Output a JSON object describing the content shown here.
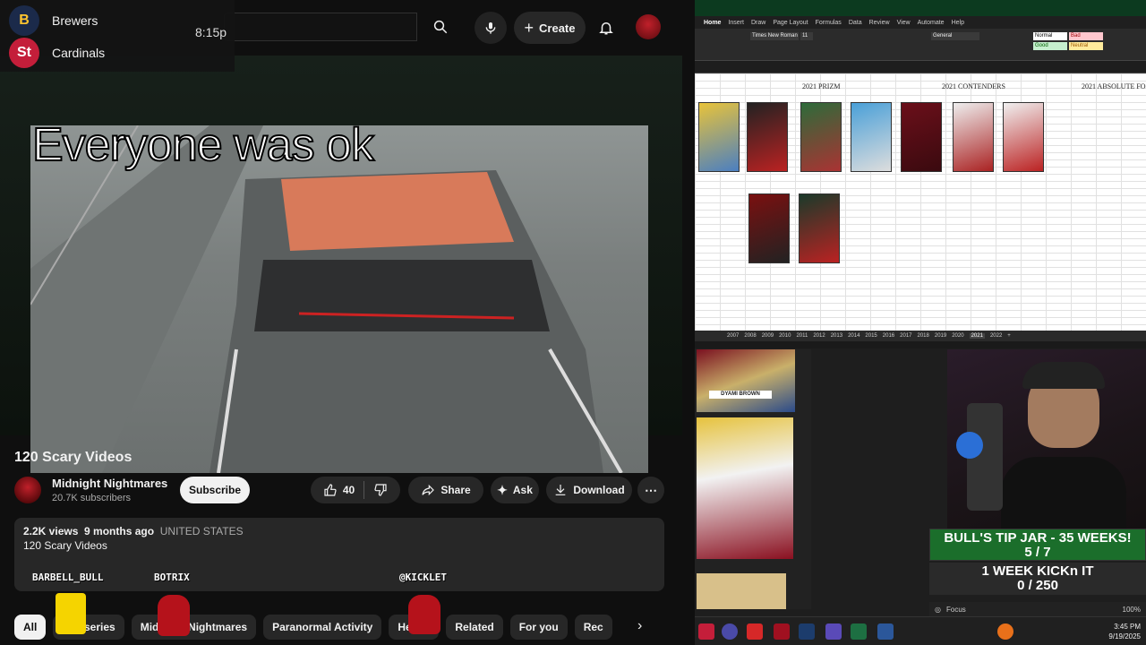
{
  "score": {
    "team1": "Brewers",
    "team2": "Cardinals",
    "time": "8:15p",
    "team1_logo": "Brewers logo",
    "team2_logo": "Cardinals logo"
  },
  "header": {
    "create_label": "Create",
    "icons": [
      "search-icon",
      "mic-icon",
      "bell-icon"
    ]
  },
  "video": {
    "caption": "Everyone was ok",
    "title": "120 Scary Videos"
  },
  "channel": {
    "name": "Midnight Nightmares",
    "subscribers": "20.7K subscribers",
    "subscribe_label": "Subscribe"
  },
  "actions": {
    "like_count": "40",
    "share_label": "Share",
    "ask_label": "Ask",
    "download_label": "Download"
  },
  "description": {
    "views": "2.2K views",
    "age": "9 months ago",
    "country": "UNITED STATES",
    "text": "120 Scary Videos"
  },
  "chips": [
    "All",
    "The series",
    "Midnight Nightmares",
    "Paranormal Activity",
    "Heists",
    "Related",
    "For you",
    "Rec"
  ],
  "overlay_users": {
    "user1": "BARBELL_BULL",
    "user2": "BOTRIX",
    "user3": "@KICKLET"
  },
  "excel": {
    "menu": [
      "Home",
      "Insert",
      "Draw",
      "Page Layout",
      "Formulas",
      "Data",
      "Review",
      "View",
      "Automate",
      "Help"
    ],
    "headers": [
      "2021 PRIZM",
      "2021 CONTENDERS",
      "2021 ABSOLUTE FO"
    ],
    "sheets": [
      "2007",
      "2008",
      "2009",
      "2010",
      "2011",
      "2012",
      "2013",
      "2014",
      "2015",
      "2016",
      "2017",
      "2018",
      "2019",
      "2020",
      "2021",
      "2022"
    ],
    "active_sheet": "2021",
    "font": "Times New Roman",
    "font_size": "11",
    "number_format": "General",
    "styles": [
      "Normal",
      "Bad",
      "Good",
      "Neutral"
    ]
  },
  "stream": {
    "tipjar_title": "BULL'S TIP JAR - 35 WEEKS!",
    "tipjar_value": "5 / 7",
    "kick_title": "1 WEEK KICKn IT",
    "kick_value": "0 / 250",
    "card_label": "DYAMI BROWN"
  },
  "taskbar": {
    "time": "3:45 PM",
    "date": "9/19/2025",
    "focus": "Focus",
    "zoom": "100%"
  }
}
